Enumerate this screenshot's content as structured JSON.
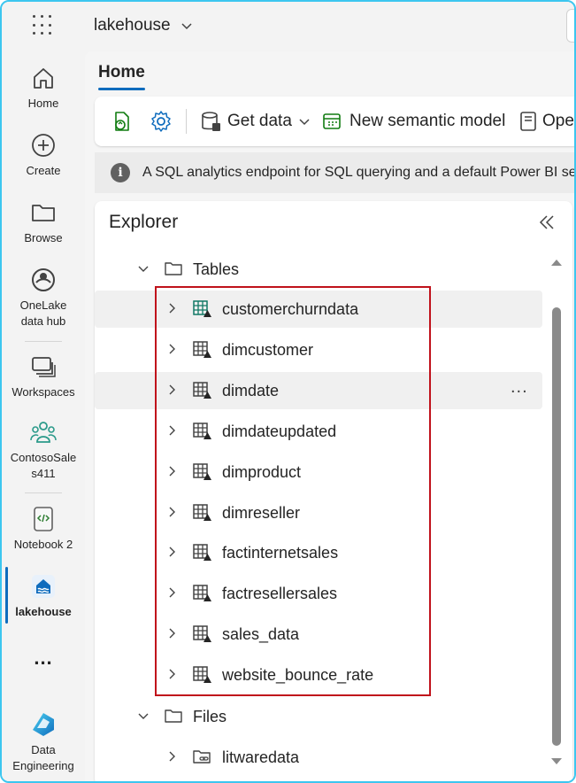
{
  "app": {
    "title": "lakehouse"
  },
  "rail": {
    "items": [
      {
        "label": "Home",
        "icon": "home-icon"
      },
      {
        "label": "Create",
        "icon": "create-plus-icon"
      },
      {
        "label": "Browse",
        "icon": "folder-icon"
      },
      {
        "label": "OneLake data hub",
        "label_lines": [
          "OneLake",
          "data hub"
        ],
        "icon": "onelake-icon"
      },
      {
        "label": "Workspaces",
        "icon": "workspaces-icon"
      },
      {
        "label_lines": [
          "ContosoSale",
          "s411"
        ],
        "label": "ContosoSales411",
        "icon": "workspace-people-icon"
      },
      {
        "label": "Notebook 2",
        "icon": "notebook-icon"
      },
      {
        "label": "lakehouse",
        "icon": "lakehouse-icon",
        "active": true
      },
      {
        "label": "...",
        "icon": "more-icon"
      },
      {
        "label_lines": [
          "Data",
          "Engineering"
        ],
        "label": "Data Engineering",
        "icon": "data-engineering-icon"
      }
    ]
  },
  "ribbon": {
    "tab": "Home",
    "get_data": "Get data",
    "new_semantic_model": "New semantic model",
    "open": "Ope"
  },
  "infobar": {
    "text": "A SQL analytics endpoint for SQL querying and a default Power BI ser"
  },
  "explorer": {
    "title": "Explorer",
    "tables_folder": "Tables",
    "tables": [
      "customerchurndata",
      "dimcustomer",
      "dimdate",
      "dimdateupdated",
      "dimproduct",
      "dimreseller",
      "factinternetsales",
      "factresellersales",
      "sales_data",
      "website_bounce_rate"
    ],
    "files_folder": "Files",
    "files": [
      "litwaredata"
    ],
    "more_label": "..."
  },
  "colors": {
    "accent": "#0f6cbd",
    "highlight_border": "#c0121b",
    "frame_border": "#3cc6ef",
    "table_new_icon": "#117865"
  }
}
